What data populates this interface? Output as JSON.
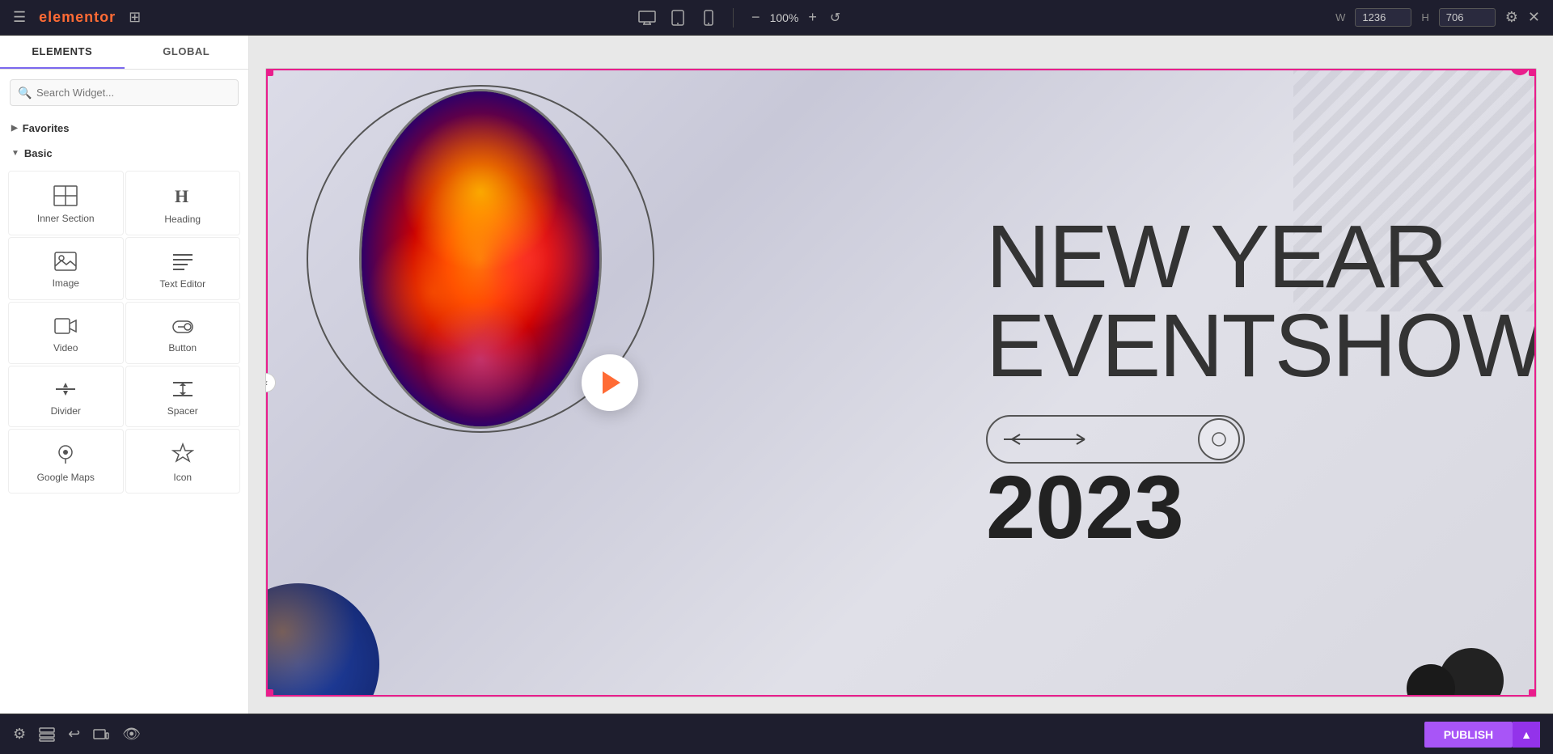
{
  "app": {
    "title": "elementor",
    "logo": "elementor"
  },
  "topbar": {
    "zoom_level": "100%",
    "width_value": "1236",
    "height_value": "706",
    "width_label": "W",
    "height_label": "H",
    "minus_label": "−",
    "plus_label": "+",
    "settings_label": "⚙",
    "close_label": "✕"
  },
  "sidebar": {
    "tab_elements": "ELEMENTS",
    "tab_global": "GLOBAL",
    "search_placeholder": "Search Widget...",
    "section_favorites": "Favorites",
    "section_basic": "Basic",
    "widgets": [
      {
        "id": "inner-section",
        "label": "Inner Section",
        "icon": "inner-section-icon"
      },
      {
        "id": "heading",
        "label": "Heading",
        "icon": "heading-icon"
      },
      {
        "id": "image",
        "label": "Image",
        "icon": "image-icon"
      },
      {
        "id": "text-editor",
        "label": "Text Editor",
        "icon": "text-editor-icon"
      },
      {
        "id": "video",
        "label": "Video",
        "icon": "video-icon"
      },
      {
        "id": "button",
        "label": "Button",
        "icon": "button-icon"
      },
      {
        "id": "divider",
        "label": "Divider",
        "icon": "divider-icon"
      },
      {
        "id": "spacer",
        "label": "Spacer",
        "icon": "spacer-icon"
      },
      {
        "id": "google-maps",
        "label": "Google Maps",
        "icon": "google-maps-icon"
      },
      {
        "id": "icon",
        "label": "Icon",
        "icon": "icon-icon"
      }
    ]
  },
  "canvas": {
    "ny_title_line1": "NEW YEAR",
    "ny_title_line2": "EVENTSHOW",
    "ny_year": "2023",
    "event_overlay_title": "New Year Event Show"
  },
  "bottombar": {
    "publish_label": "PUBLISH"
  }
}
